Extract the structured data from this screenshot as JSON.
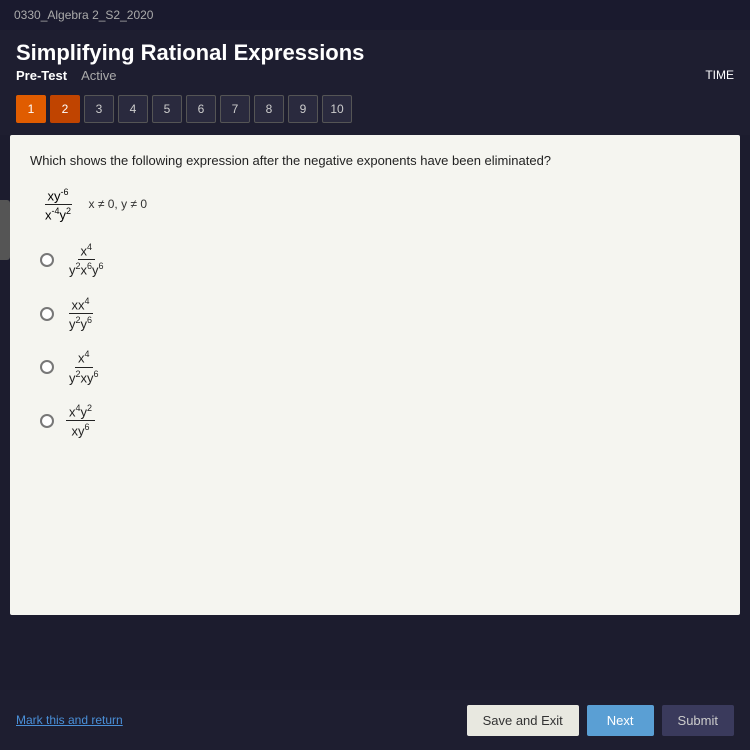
{
  "topBar": {
    "courseLabel": "0330_Algebra 2_S2_2020"
  },
  "header": {
    "title": "Simplifying Rational Expressions",
    "pretest": "Pre-Test",
    "status": "Active"
  },
  "navigation": {
    "numbers": [
      "1",
      "2",
      "3",
      "4",
      "5",
      "6",
      "7",
      "8",
      "9",
      "10"
    ],
    "active": 1,
    "current": 2,
    "timerLabel": "TIME"
  },
  "question": {
    "text": "Which shows the following expression after the negative exponents have been eliminated?",
    "expression": {
      "numerator": "xy⁻⁶",
      "denominator": "x⁻⁴y²",
      "constraint": "x ≠ 0, y ≠ 0"
    }
  },
  "options": [
    {
      "id": "A",
      "numerator": "x⁴",
      "denominator": "y²x⁶y⁶"
    },
    {
      "id": "B",
      "numerator": "xx⁴",
      "denominator": "y²y⁶"
    },
    {
      "id": "C",
      "numerator": "x⁴",
      "denominator": "y²xy⁶"
    },
    {
      "id": "D",
      "numerator": "x⁴y²",
      "denominator": "xy⁶"
    }
  ],
  "footer": {
    "markLink": "Mark this and return",
    "saveExitBtn": "Save and Exit",
    "nextBtn": "Next",
    "submitBtn": "Submit"
  }
}
